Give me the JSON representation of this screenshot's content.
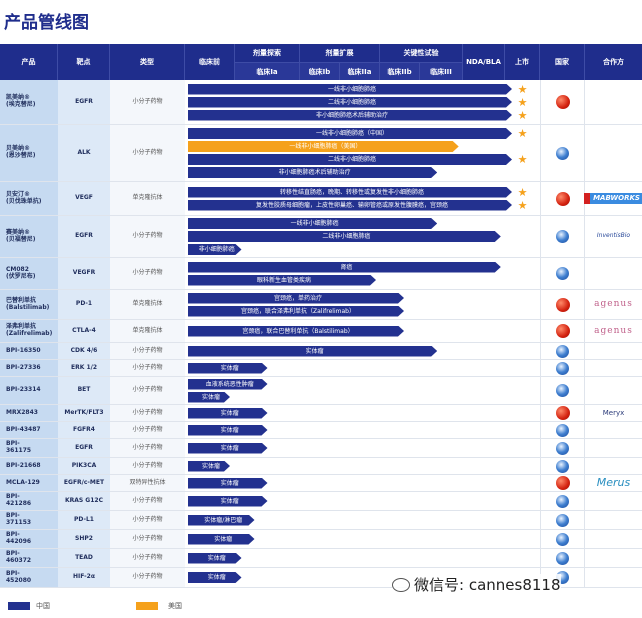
{
  "title": "产品管线图",
  "header": {
    "product": "产品",
    "target": "靶点",
    "type": "类型",
    "preclinical": "临床前",
    "dose_escalation": "剂量探索",
    "dose_expansion": "剂量扩展",
    "pivotal": "关键性试验",
    "phase_ia": "临床Ia",
    "phase_ib": "临床Ib",
    "phase_iia": "临床IIa",
    "phase_iib": "临床IIb",
    "phase_iii": "临床III",
    "nda": "NDA/BLA",
    "marketed": "上市",
    "country": "国家",
    "partner": "合作方"
  },
  "stage_scale": [
    "临床前",
    "临床Ia",
    "临床Ib",
    "临床IIa",
    "临床IIb",
    "临床III",
    "NDA/BLA",
    "上市"
  ],
  "colors": {
    "china": "#23318f",
    "us": "#f5a11c",
    "header": "#1f2d8c"
  },
  "rows": [
    {
      "product": "凯美纳®\n(埃克替尼)",
      "target": "EGFR",
      "type": "小分子药物",
      "country": "china-flag-icon",
      "partner": "",
      "bars": [
        {
          "label": "一线非小细胞肺癌",
          "stage": 7.2,
          "region": "china",
          "marketed": true
        },
        {
          "label": "二线非小细胞肺癌",
          "stage": 7.2,
          "region": "china",
          "marketed": true
        },
        {
          "label": "非小细胞肺癌术后辅助治疗",
          "stage": 7.2,
          "region": "china",
          "marketed": true
        }
      ]
    },
    {
      "product": "贝美纳®\n(恩沙替尼)",
      "target": "ALK",
      "type": "小分子药物",
      "country": "globe-icon",
      "partner": "",
      "bars": [
        {
          "label": "一线非小细胞肺癌（中国）",
          "stage": 7.2,
          "region": "china",
          "marketed": true
        },
        {
          "label": "一线非小细胞肺癌（美国）",
          "stage": 5.9,
          "region": "us",
          "marketed": false
        },
        {
          "label": "二线非小细胞肺癌",
          "stage": 7.2,
          "region": "china",
          "marketed": true
        },
        {
          "label": "非小细胞肺癌术后辅助治疗",
          "stage": 5.4,
          "region": "china",
          "marketed": false
        }
      ]
    },
    {
      "product": "贝安汀®\n(贝伐珠单抗)",
      "target": "VEGF",
      "type": "单克隆抗体",
      "country": "china-flag-icon",
      "partner": "MABWORKS",
      "bars": [
        {
          "label": "转移性结直肠癌，晚期、转移性或复发性非小细胞肺癌",
          "stage": 7.2,
          "region": "china",
          "marketed": true
        },
        {
          "label": "复发性胶质母细胞瘤，上皮性卵巢癌、输卵管癌或原发性腹膜癌，宫颈癌",
          "stage": 7.2,
          "region": "china",
          "marketed": true
        }
      ]
    },
    {
      "product": "赛美纳®\n(贝福替尼)",
      "target": "EGFR",
      "type": "小分子药物",
      "country": "globe-icon",
      "partner": "InventisBio",
      "bars": [
        {
          "label": "一线非小细胞肺癌",
          "stage": 5.4,
          "region": "china",
          "marketed": false
        },
        {
          "label": "二线非小细胞肺癌",
          "stage": 6.9,
          "region": "china",
          "marketed": false
        },
        {
          "label": "非小细胞肺癌",
          "stage": 1.1,
          "region": "china",
          "marketed": false
        }
      ]
    },
    {
      "product": "CM082\n(伏罗尼布)",
      "target": "VEGFR",
      "type": "小分子药物",
      "country": "globe-icon",
      "partner": "",
      "bars": [
        {
          "label": "肾癌",
          "stage": 6.9,
          "region": "china",
          "marketed": false
        },
        {
          "label": "眼科新生血管类疾病",
          "stage": 3.9,
          "region": "china",
          "marketed": false
        }
      ]
    },
    {
      "product": "巴替利单抗\n(Balstilimab)",
      "target": "PD-1",
      "type": "单克隆抗体",
      "country": "china-flag-icon",
      "partner": "agenus",
      "bars": [
        {
          "label": "宫颈癌，单药治疗",
          "stage": 4.6,
          "region": "china",
          "marketed": false
        },
        {
          "label": "宫颈癌，联合泽弗利单抗（Zalifrelimab）",
          "stage": 4.6,
          "region": "china",
          "marketed": false
        }
      ]
    },
    {
      "product": "泽弗利单抗\n(Zalifrelimab)",
      "target": "CTLA-4",
      "type": "单克隆抗体",
      "country": "china-flag-icon",
      "partner": "agenus",
      "bars": [
        {
          "label": "宫颈癌，联合巴替利单抗（Balstilimab）",
          "stage": 4.6,
          "region": "china",
          "marketed": false
        }
      ]
    },
    {
      "product": "BPI-16350",
      "target": "CDK 4/6",
      "type": "小分子药物",
      "country": "globe-icon",
      "partner": "",
      "bars": [
        {
          "label": "实体瘤",
          "stage": 5.4,
          "region": "china",
          "marketed": false
        }
      ]
    },
    {
      "product": "BPI-27336",
      "target": "ERK 1/2",
      "type": "小分子药物",
      "country": "globe-icon",
      "partner": "",
      "bars": [
        {
          "label": "实体瘤",
          "stage": 1.5,
          "region": "china",
          "marketed": false
        }
      ]
    },
    {
      "product": "BPI-23314",
      "target": "BET",
      "type": "小分子药物",
      "country": "globe-icon",
      "partner": "",
      "bars": [
        {
          "label": "血液系统恶性肿瘤",
          "stage": 1.5,
          "region": "china",
          "marketed": false
        },
        {
          "label": "实体瘤",
          "stage": 0.9,
          "region": "china",
          "marketed": false
        }
      ]
    },
    {
      "product": "MRX2843",
      "target": "MerTK/FLT3",
      "type": "小分子药物",
      "country": "china-flag-icon",
      "partner": "Meryx",
      "bars": [
        {
          "label": "实体瘤",
          "stage": 1.5,
          "region": "china",
          "marketed": false
        }
      ]
    },
    {
      "product": "BPI-43487",
      "target": "FGFR4",
      "type": "小分子药物",
      "country": "globe-icon",
      "partner": "",
      "bars": [
        {
          "label": "实体瘤",
          "stage": 1.5,
          "region": "china",
          "marketed": false
        }
      ]
    },
    {
      "product": "BPI-\n361175",
      "target": "EGFR",
      "type": "小分子药物",
      "country": "globe-icon",
      "partner": "",
      "bars": [
        {
          "label": "实体瘤",
          "stage": 1.5,
          "region": "china",
          "marketed": false
        }
      ]
    },
    {
      "product": "BPI-21668",
      "target": "PIK3CA",
      "type": "小分子药物",
      "country": "globe-icon",
      "partner": "",
      "bars": [
        {
          "label": "实体瘤",
          "stage": 0.9,
          "region": "china",
          "marketed": false
        }
      ]
    },
    {
      "product": "MCLA-129",
      "target": "EGFR/c-MET",
      "type": "双特异性抗体",
      "country": "china-flag-icon",
      "partner": "Merus",
      "bars": [
        {
          "label": "实体瘤",
          "stage": 1.5,
          "region": "china",
          "marketed": false
        }
      ]
    },
    {
      "product": "BPI-\n421286",
      "target": "KRAS G12C",
      "type": "小分子药物",
      "country": "globe-icon",
      "partner": "",
      "bars": [
        {
          "label": "实体瘤",
          "stage": 1.5,
          "region": "china",
          "marketed": false
        }
      ]
    },
    {
      "product": "BPI-\n371153",
      "target": "PD-L1",
      "type": "小分子药物",
      "country": "globe-icon",
      "partner": "",
      "bars": [
        {
          "label": "实体瘤/淋巴瘤",
          "stage": 1.3,
          "region": "china",
          "marketed": false
        }
      ]
    },
    {
      "product": "BPI-\n442096",
      "target": "SHP2",
      "type": "小分子药物",
      "country": "globe-icon",
      "partner": "",
      "bars": [
        {
          "label": "实体瘤",
          "stage": 1.3,
          "region": "china",
          "marketed": false
        }
      ]
    },
    {
      "product": "BPI-\n460372",
      "target": "TEAD",
      "type": "小分子药物",
      "country": "globe-icon",
      "partner": "",
      "bars": [
        {
          "label": "实体瘤",
          "stage": 1.1,
          "region": "china",
          "marketed": false
        }
      ]
    },
    {
      "product": "BPI-\n452080",
      "target": "HIF-2α",
      "type": "小分子药物",
      "country": "globe-icon",
      "partner": "",
      "bars": [
        {
          "label": "实体瘤",
          "stage": 1.1,
          "region": "china",
          "marketed": false
        }
      ]
    }
  ],
  "legend": {
    "china": "中国",
    "us": "美国"
  },
  "watermark": "微信号: cannes8118"
}
